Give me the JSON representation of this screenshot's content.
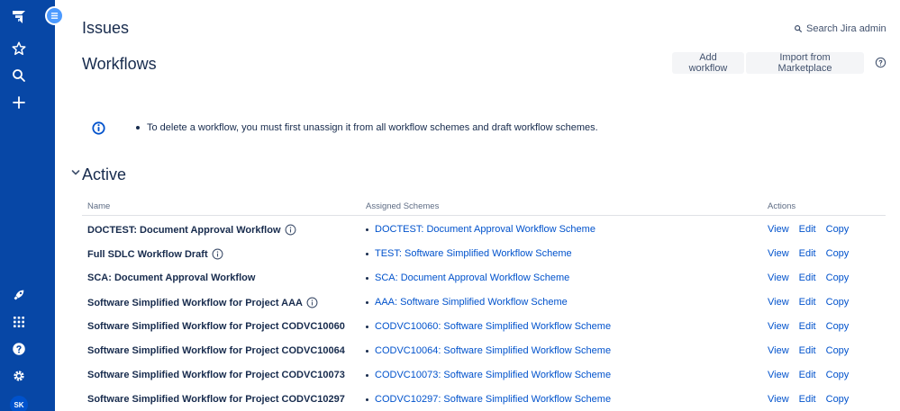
{
  "sidebar": {
    "user_initials": "SK",
    "icons": [
      "jira-logo-icon",
      "star-icon",
      "search-icon",
      "plus-icon",
      "rocket-icon",
      "app-grid-icon",
      "help-icon",
      "gear-icon"
    ]
  },
  "header": {
    "title": "Issues",
    "search_label": "Search Jira admin"
  },
  "page": {
    "title": "Workflows",
    "add_button": "Add workflow",
    "import_button": "Import from Marketplace",
    "info_message": "To delete a workflow, you must first unassign it from all workflow schemes and draft workflow schemes.",
    "section_title": "Active"
  },
  "table": {
    "columns": [
      "Name",
      "Assigned Schemes",
      "Actions"
    ],
    "action_labels": [
      "View",
      "Edit",
      "Copy"
    ],
    "rows": [
      {
        "name": "DOCTEST: Document Approval Workflow",
        "has_info": true,
        "scheme": "DOCTEST: Document Approval Workflow Scheme"
      },
      {
        "name": "Full SDLC Workflow Draft",
        "has_info": true,
        "scheme": "TEST: Software Simplified Workflow Scheme"
      },
      {
        "name": "SCA: Document Approval Workflow",
        "has_info": false,
        "scheme": "SCA: Document Approval Workflow Scheme"
      },
      {
        "name": "Software Simplified Workflow for Project AAA",
        "has_info": true,
        "scheme": "AAA: Software Simplified Workflow Scheme"
      },
      {
        "name": "Software Simplified Workflow for Project CODVC10060",
        "has_info": false,
        "scheme": "CODVC10060: Software Simplified Workflow Scheme"
      },
      {
        "name": "Software Simplified Workflow for Project CODVC10064",
        "has_info": false,
        "scheme": "CODVC10064: Software Simplified Workflow Scheme"
      },
      {
        "name": "Software Simplified Workflow for Project CODVC10073",
        "has_info": false,
        "scheme": "CODVC10073: Software Simplified Workflow Scheme"
      },
      {
        "name": "Software Simplified Workflow for Project CODVC10297",
        "has_info": false,
        "scheme": "CODVC10297: Software Simplified Workflow Scheme"
      }
    ]
  },
  "colors": {
    "sidebar": "#0747a6",
    "link": "#0052cc",
    "text": "#172b4d"
  }
}
